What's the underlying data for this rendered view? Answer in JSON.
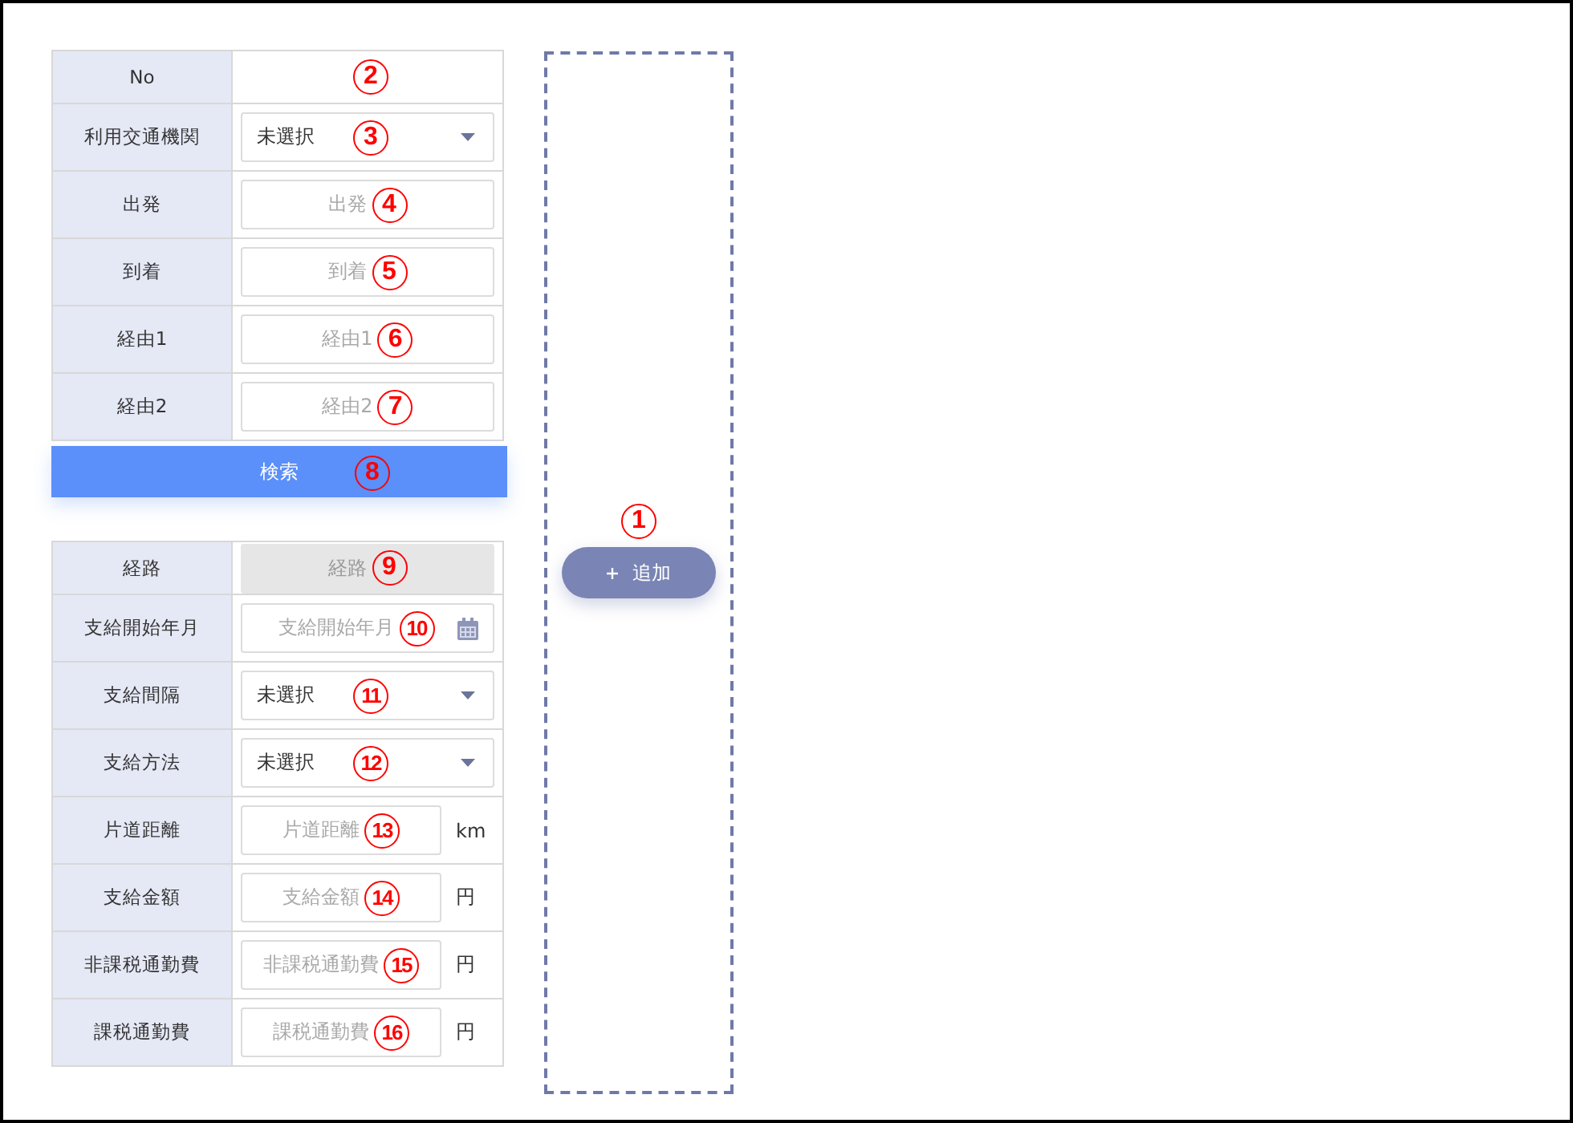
{
  "search_form": {
    "rows": [
      {
        "label": "No",
        "kind": "static",
        "marker": "2"
      },
      {
        "label": "利用交通機関",
        "kind": "select",
        "value": "未選択",
        "disabled": false,
        "marker": "3"
      },
      {
        "label": "出発",
        "kind": "input",
        "placeholder": "出発",
        "disabled": false,
        "marker": "4"
      },
      {
        "label": "到着",
        "kind": "input",
        "placeholder": "到着",
        "disabled": false,
        "marker": "5"
      },
      {
        "label": "経由1",
        "kind": "input",
        "placeholder": "経由1",
        "disabled": false,
        "marker": "6"
      },
      {
        "label": "経由2",
        "kind": "input",
        "placeholder": "経由2",
        "disabled": false,
        "marker": "7"
      }
    ],
    "search_button": {
      "label": "検索",
      "marker": "8"
    }
  },
  "payment_form": {
    "rows": [
      {
        "label": "経路",
        "kind": "input",
        "placeholder": "経路",
        "disabled": true,
        "marker": "9"
      },
      {
        "label": "支給開始年月",
        "kind": "date",
        "placeholder": "支給開始年月",
        "disabled": false,
        "marker": "10"
      },
      {
        "label": "支給間隔",
        "kind": "select",
        "value": "未選択",
        "disabled": false,
        "marker": "11"
      },
      {
        "label": "支給方法",
        "kind": "select",
        "value": "未選択",
        "disabled": false,
        "marker": "12"
      },
      {
        "label": "片道距離",
        "kind": "input",
        "placeholder": "片道距離",
        "unit": "km",
        "disabled": false,
        "marker": "13"
      },
      {
        "label": "支給金額",
        "kind": "input",
        "placeholder": "支給金額",
        "unit": "円",
        "disabled": false,
        "marker": "14"
      },
      {
        "label": "非課税通勤費",
        "kind": "input",
        "placeholder": "非課税通勤費",
        "unit": "円",
        "disabled": false,
        "marker": "15"
      },
      {
        "label": "課税通勤費",
        "kind": "input",
        "placeholder": "課税通勤費",
        "unit": "円",
        "disabled": false,
        "marker": "16"
      }
    ]
  },
  "add_panel": {
    "button": {
      "label": "追加",
      "marker": "1"
    }
  }
}
